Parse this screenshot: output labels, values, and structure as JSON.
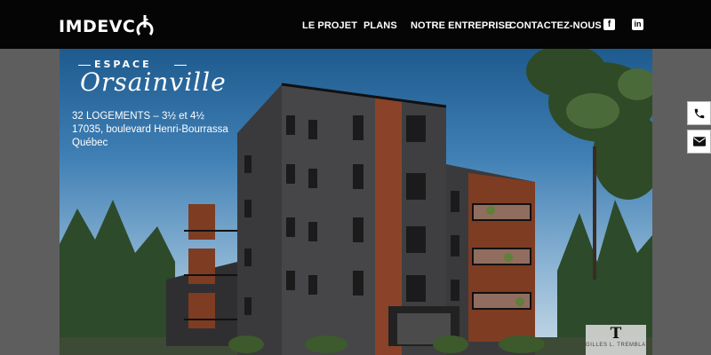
{
  "header": {
    "logo_text": "IMDEVC",
    "nav": [
      "LE PROJET",
      "PLANS",
      "NOTRE ENTREPRISE",
      "CONTACTEZ-NOUS"
    ],
    "social_icons": [
      "facebook-icon",
      "linkedin-icon"
    ]
  },
  "hero": {
    "brand_top": "ESPACE",
    "brand_script": "Orsainville",
    "info_lines": [
      "32 LOGEMENTS – 3½ et 4½",
      "17035, boulevard Henri-Bourrassa",
      "Québec"
    ],
    "credit_mark": "T",
    "credit_name": "GILLES L. TREMBLAY"
  },
  "side_buttons": [
    "phone-icon",
    "envelope-icon"
  ],
  "colors": {
    "header_bg": "#050505",
    "page_bg": "#5e5e5e",
    "wood": "#8a4328",
    "brick": "#3d3d3f"
  }
}
